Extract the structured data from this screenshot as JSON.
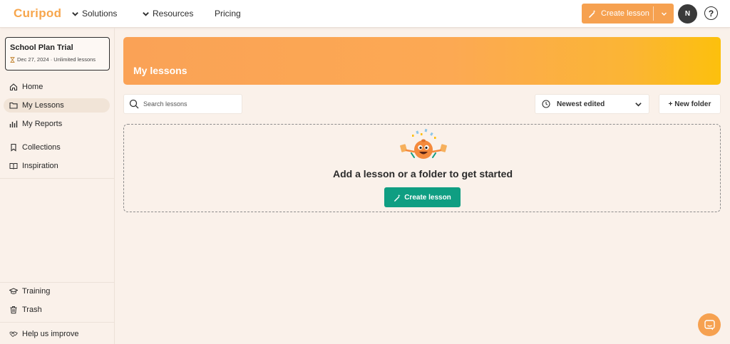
{
  "app": {
    "logo": "Curipod"
  },
  "header": {
    "nav": [
      {
        "label": "Solutions"
      },
      {
        "label": "Resources"
      },
      {
        "label": "Pricing"
      }
    ],
    "create_label": "Create lesson",
    "avatar_initial": "N",
    "help_label": "?"
  },
  "sidebar": {
    "plan": {
      "title": "School Plan Trial",
      "subtitle": "Dec 27, 2024 · Unlimited lessons"
    },
    "items": [
      {
        "label": "Home",
        "icon": "home-icon"
      },
      {
        "label": "My Lessons",
        "icon": "folder-icon",
        "active": true
      },
      {
        "label": "My Reports",
        "icon": "bar-chart-icon"
      },
      {
        "label": "Collections",
        "icon": "bookmark-icon"
      },
      {
        "label": "Inspiration",
        "icon": "book-open-icon"
      }
    ],
    "bottom": [
      {
        "label": "Training",
        "icon": "graduation-cap-icon"
      },
      {
        "label": "Trash",
        "icon": "trash-icon"
      }
    ],
    "feedback": {
      "label": "Help us improve",
      "icon": "handshake-icon"
    }
  },
  "main": {
    "title": "My lessons",
    "search_placeholder": "Search lessons",
    "sort_label": "Newest edited",
    "new_folder_label": "+ New folder",
    "empty_title": "Add a lesson or a folder to get started",
    "empty_button": "Create lesson"
  },
  "colors": {
    "accent": "#f6a150",
    "banner_start": "#faa256",
    "banner_end": "#fcc00d",
    "primary_green": "#0f9e82"
  }
}
